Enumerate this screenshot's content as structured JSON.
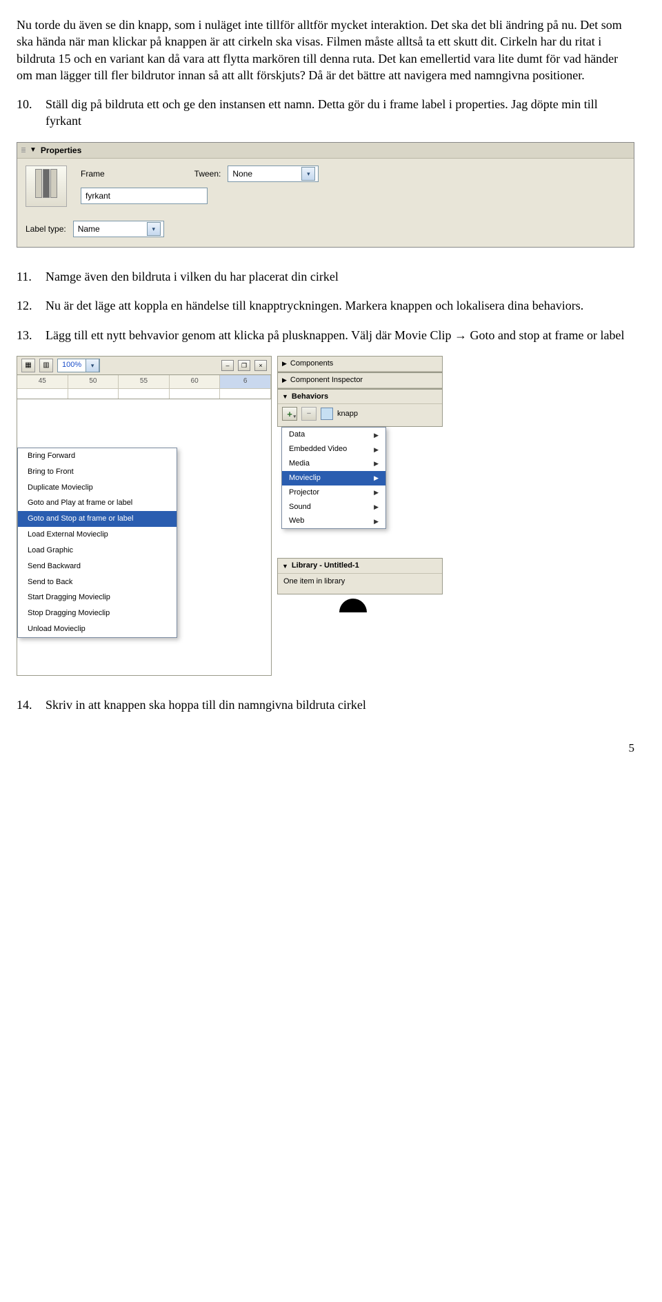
{
  "para1": "Nu torde du även se din knapp, som i nuläget inte tillför alltför mycket interaktion. Det ska det bli ändring på nu. Det som ska hända när man klickar på knappen är att cirkeln ska visas. Filmen måste alltså ta ett skutt dit. Cirkeln har du ritat i bildruta 15 och en variant kan då vara att flytta markören till denna ruta. Det kan emellertid vara lite dumt för vad händer om man lägger till fler bildrutor innan så att allt förskjuts? Då är det bättre att navigera med namngivna positioner.",
  "step10_n": "10.",
  "step10": "Ställ dig på bildruta ett och ge den instansen ett namn. Detta gör du i frame label i properties. Jag döpte min till fyrkant",
  "properties": {
    "panel_title": "Properties",
    "frame_label": "Frame",
    "frame_value": "fyrkant",
    "tween_label": "Tween:",
    "tween_value": "None",
    "labeltype_label": "Label type:",
    "labeltype_value": "Name"
  },
  "step11_n": "11.",
  "step11": "Namge även den bildruta i vilken du har placerat din cirkel",
  "step12_n": "12.",
  "step12": "Nu är det läge att koppla en händelse till knapptryckningen. Markera knappen och lokalisera dina behaviors.",
  "step13_n": "13.",
  "step13": "Lägg till ett nytt behvavior genom att klicka på plusknappen. Välj där Movie Clip → Goto and stop at frame or label",
  "shot2": {
    "zoom": "100%",
    "ruler": [
      "45",
      "50",
      "55",
      "60",
      "6"
    ],
    "context_menu": [
      "Bring Forward",
      "Bring to Front",
      "Duplicate Movieclip",
      "Goto and Play at frame or label",
      "Goto and Stop at frame or label",
      "Load External Movieclip",
      "Load Graphic",
      "Send Backward",
      "Send to Back",
      "Start Dragging Movieclip",
      "Stop Dragging Movieclip",
      "Unload Movieclip"
    ],
    "context_selected": 4,
    "right_panels": {
      "components": "Components",
      "component_inspector": "Component Inspector",
      "behaviors": "Behaviors",
      "behaviors_target": "knapp",
      "library_title": "Library - Untitled-1",
      "library_body": "One item in library"
    },
    "submenu": [
      "Data",
      "Embedded Video",
      "Media",
      "Movieclip",
      "Projector",
      "Sound",
      "Web"
    ],
    "submenu_selected": 3
  },
  "step14_n": "14.",
  "step14": "Skriv in att knappen ska hoppa till din namngivna bildruta cirkel",
  "page_number": "5"
}
